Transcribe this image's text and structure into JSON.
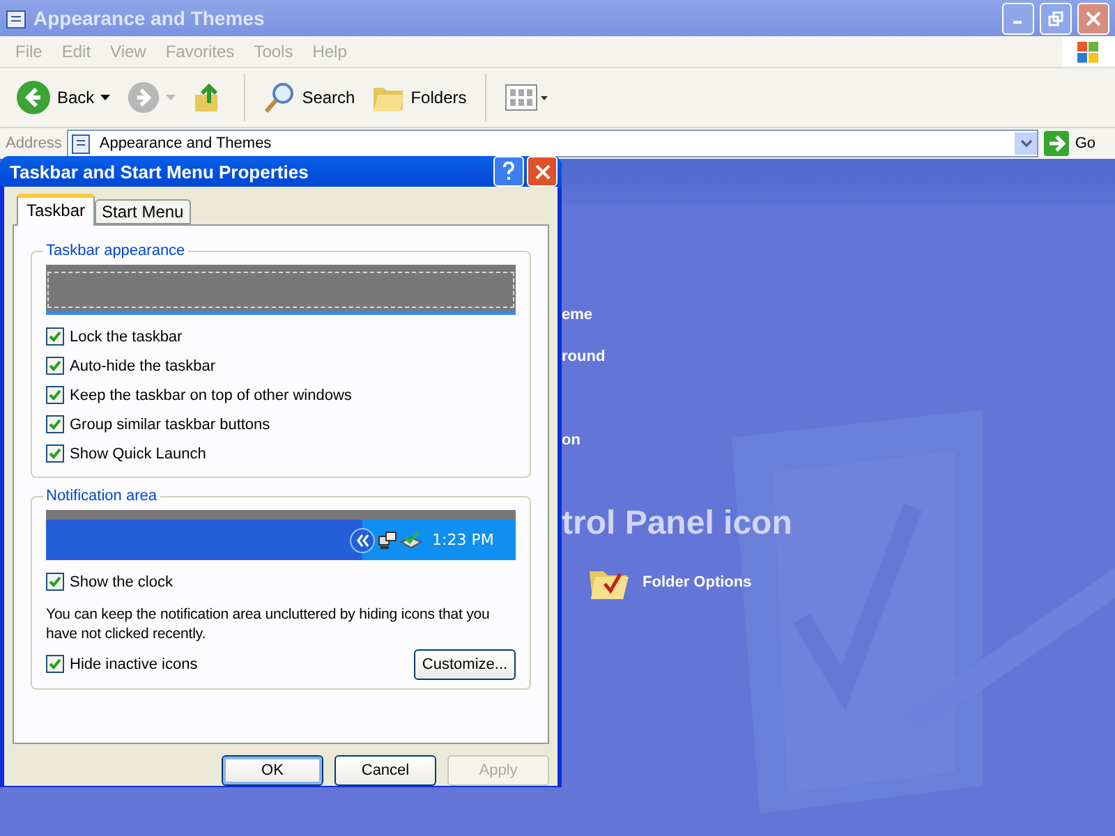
{
  "window": {
    "title": "Appearance and Themes"
  },
  "menu": [
    "File",
    "Edit",
    "View",
    "Favorites",
    "Tools",
    "Help"
  ],
  "toolbar": [
    {
      "kind": "back",
      "label": "Back"
    },
    {
      "kind": "forward"
    },
    {
      "kind": "up"
    },
    {
      "kind": "search",
      "label": "Search"
    },
    {
      "kind": "folders",
      "label": "Folders"
    },
    {
      "kind": "views"
    }
  ],
  "address": {
    "label": "Address",
    "value": "Appearance and Themes",
    "go": "Go"
  },
  "content": {
    "tasks": [
      "eme",
      "round",
      "on"
    ],
    "heading": "trol Panel icon",
    "items": [
      {
        "label": "Folder Options"
      }
    ]
  },
  "dialog": {
    "title": "Taskbar and Start Menu Properties",
    "tabs": [
      {
        "label": "Taskbar",
        "selected": true
      },
      {
        "label": "Start Menu",
        "selected": false
      }
    ],
    "taskbar_group": {
      "title": "Taskbar appearance",
      "options": [
        {
          "label": "Lock the taskbar",
          "checked": true
        },
        {
          "label": "Auto-hide the taskbar",
          "checked": true
        },
        {
          "label": "Keep the taskbar on top of other windows",
          "checked": true
        },
        {
          "label": "Group similar taskbar buttons",
          "checked": true
        },
        {
          "label": "Show Quick Launch",
          "checked": true
        }
      ]
    },
    "notification_group": {
      "title": "Notification area",
      "clock_preview": "1:23 PM",
      "show_clock": {
        "label": "Show the clock",
        "checked": true
      },
      "description": "You can keep the notification area uncluttered by hiding icons that you have not clicked recently.",
      "hide_inactive": {
        "label": "Hide inactive icons",
        "checked": true
      },
      "customize": "Customize..."
    },
    "buttons": [
      {
        "label": "OK",
        "default": true,
        "disabled": false
      },
      {
        "label": "Cancel",
        "default": false,
        "disabled": false
      },
      {
        "label": "Apply",
        "default": false,
        "disabled": true
      }
    ]
  }
}
